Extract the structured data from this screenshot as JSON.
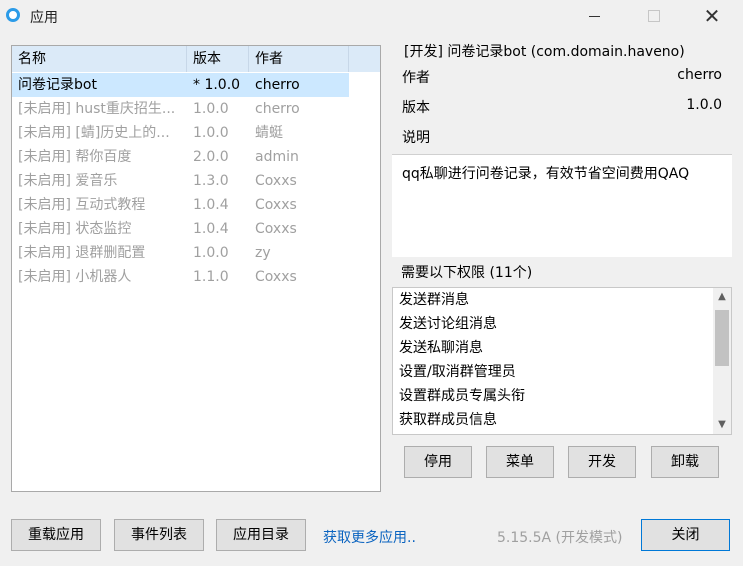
{
  "window": {
    "title": "应用",
    "minimize_icon": "minimize-icon",
    "maximize_icon": "maximize-icon",
    "close_icon": "close-icon",
    "close_glyph": "✕"
  },
  "table": {
    "headers": [
      "名称",
      "版本",
      "作者"
    ],
    "rows": [
      {
        "name": "问卷记录bot",
        "version": "* 1.0.0",
        "author": "cherro",
        "selected": true,
        "disabled": false
      },
      {
        "name": "[未启用] hust重庆招生...",
        "version": "1.0.0",
        "author": "cherro",
        "selected": false,
        "disabled": true
      },
      {
        "name": "[未启用] [蜻]历史上的...",
        "version": "1.0.0",
        "author": "蜻蜓",
        "selected": false,
        "disabled": true
      },
      {
        "name": "[未启用] 帮你百度",
        "version": "2.0.0",
        "author": "admin",
        "selected": false,
        "disabled": true
      },
      {
        "name": "[未启用] 爱音乐",
        "version": "1.3.0",
        "author": "Coxxs",
        "selected": false,
        "disabled": true
      },
      {
        "name": "[未启用] 互动式教程",
        "version": "1.0.4",
        "author": "Coxxs",
        "selected": false,
        "disabled": true
      },
      {
        "name": "[未启用] 状态监控",
        "version": "1.0.4",
        "author": "Coxxs",
        "selected": false,
        "disabled": true
      },
      {
        "name": "[未启用] 退群删配置",
        "version": "1.0.0",
        "author": "zy",
        "selected": false,
        "disabled": true
      },
      {
        "name": "[未启用] 小机器人",
        "version": "1.1.0",
        "author": "Coxxs",
        "selected": false,
        "disabled": true
      }
    ]
  },
  "details": {
    "group_title": "[开发] 问卷记录bot (com.domain.haveno)",
    "author_label": "作者",
    "author_value": "cherro",
    "version_label": "版本",
    "version_value": "1.0.0",
    "desc_label": "说明",
    "description": "qq私聊进行问卷记录，有效节省空间费用QAQ",
    "permissions_title": "需要以下权限 (11个)",
    "permissions": [
      "发送群消息",
      "发送讨论组消息",
      "发送私聊消息",
      "设置/取消群管理员",
      "设置群成员专属头衔",
      "获取群成员信息"
    ],
    "scroll_up_glyph": "▲",
    "scroll_down_glyph": "▼"
  },
  "panel_buttons": {
    "disable": "停用",
    "menu": "菜单",
    "dev": "开发",
    "uninstall": "卸载"
  },
  "footer": {
    "reload": "重载应用",
    "events": "事件列表",
    "app_dir": "应用目录",
    "more_link": "获取更多应用..",
    "version": "5.15.5A (开发模式)",
    "close": "关闭"
  },
  "colors": {
    "selection": "#cce8ff",
    "header_bg": "#dbeaf8",
    "link": "#0b64c0",
    "disabled_text": "#a0a0a0",
    "app_icon": "#2b9be8"
  }
}
